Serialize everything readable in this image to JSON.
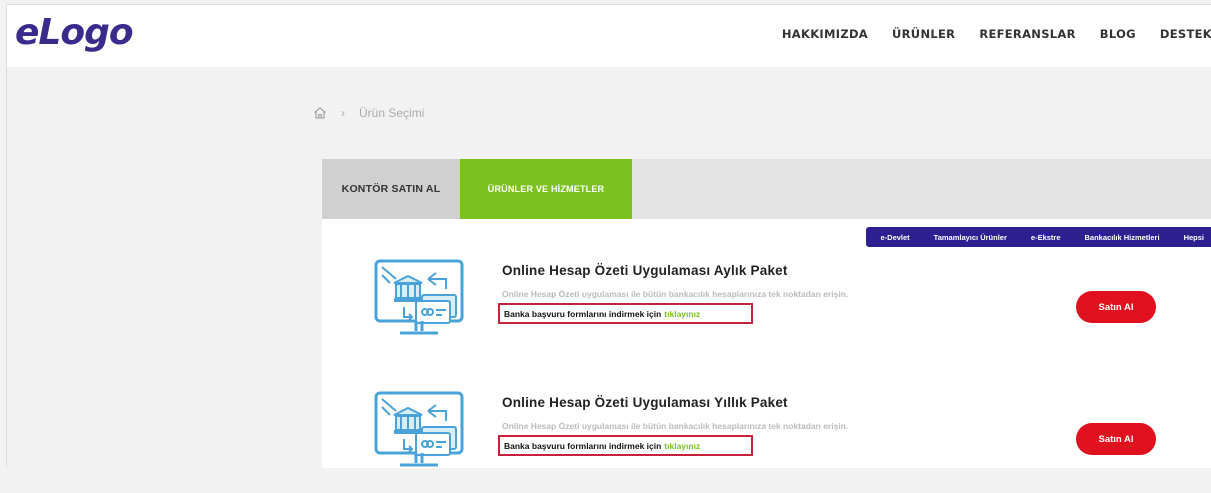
{
  "header": {
    "logo_text": "eLogo",
    "nav": [
      "HAKKIMIZDA",
      "ÜRÜNLER",
      "REFERANSLAR",
      "BLOG",
      "DESTEK"
    ]
  },
  "breadcrumb": {
    "separator": "›",
    "current": "Ürün Seçimi"
  },
  "tabs": [
    {
      "label": "KONTÖR SATIN AL",
      "active": false
    },
    {
      "label": "ÜRÜNLER VE HİZMETLER",
      "active": true
    }
  ],
  "filters": [
    "e-Devlet",
    "Tamamlayıcı Ürünler",
    "e-Ekstre",
    "Bankacılık Hizmetleri",
    "Hepsi"
  ],
  "products": [
    {
      "title": "Online Hesap Özeti Uygulaması Aylık Paket",
      "description": "Online Hesap Özeti uygulaması ile bütün bankacılık hesaplarınıza tek noktadan erişin.",
      "download_text": "Banka başvuru formlarını indirmek için",
      "download_link": "tıklayınız",
      "button": "Satın Al"
    },
    {
      "title": "Online Hesap Özeti Uygulaması Yıllık Paket",
      "description": "Online Hesap Özeti uygulaması ile bütün bankacılık hesaplarınıza tek noktadan erişin.",
      "download_text": "Banka başvuru formlarını indirmek için",
      "download_link": "tıklayınız",
      "button": "Satın Al"
    }
  ],
  "colors": {
    "brand": "#3a2a8c",
    "accent_green": "#7bc21f",
    "buy_red": "#e0101e",
    "filter_bar": "#2d1f8f",
    "highlight_border": "#c8213b"
  }
}
